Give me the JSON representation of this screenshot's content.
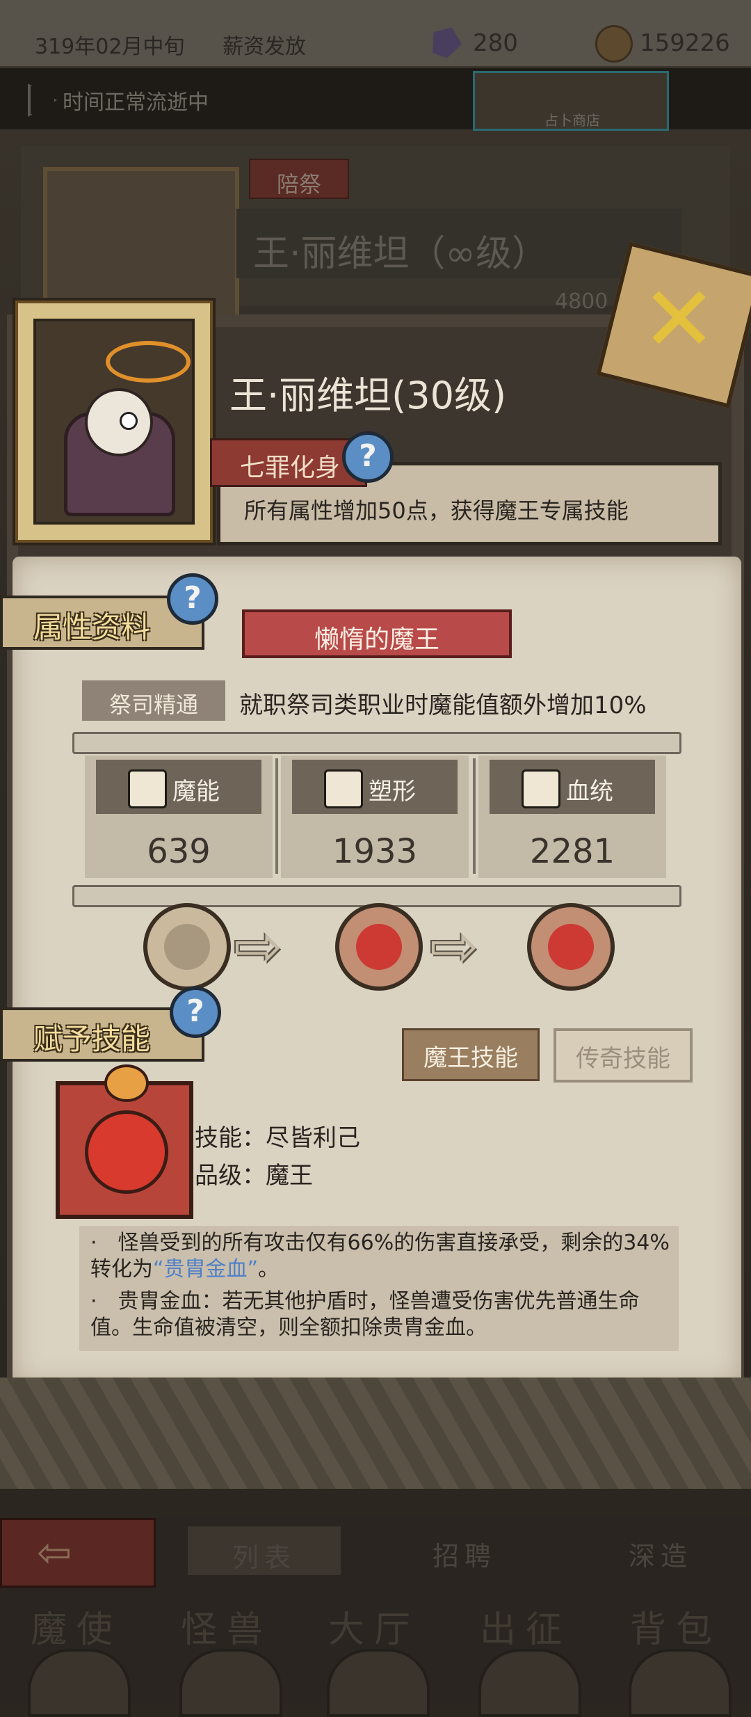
{
  "top_bar": {
    "date": "319年02月中旬",
    "event": "薪资发放",
    "gems": "280",
    "gold": "159226"
  },
  "time_bar": {
    "status": "时间正常流逝中",
    "shop_label": "占卜商店"
  },
  "background_panel": {
    "tag": "陪祭",
    "name": "王·丽维坦（∞级）",
    "number": "4800"
  },
  "hero": {
    "name": "王·丽维坦(30级)",
    "sin_title": "七罪化身",
    "sin_desc": "所有属性增加50点，获得魔王专属技能"
  },
  "attributes": {
    "section_label": "属性资料",
    "title": "懒惰的魔王",
    "mastery_label": "祭司精通",
    "mastery_desc": "就职祭司类职业时魔能值额外增加10%",
    "stats": [
      {
        "label": "魔能",
        "value": "639",
        "icon": "magic-fist-icon"
      },
      {
        "label": "塑形",
        "value": "1933",
        "icon": "armor-icon"
      },
      {
        "label": "血统",
        "value": "2281",
        "icon": "gear-sun-icon"
      }
    ]
  },
  "skill": {
    "section_label": "赋予技能",
    "tab_demon": "魔王技能",
    "tab_legend": "传奇技能",
    "name_line": "技能：尽皆利己",
    "grade_line": "品级：魔王",
    "desc_1a": "·　怪兽受到的所有攻击仅有66%的伤害直接承受，剩余的34%转化为",
    "desc_1_highlight": "“贵胄金血”",
    "desc_1b": "。",
    "desc_2": "·　贵胄金血：若无其他护盾时，怪兽遭受伤害优先普通生命值。生命值被清空，则全额扣除贵胄金血。"
  },
  "nav": {
    "tab_list": "列表",
    "tab_recruit": "招聘",
    "tab_forge": "深造",
    "menu": [
      "魔使",
      "怪兽",
      "大厅",
      "出征",
      "背包"
    ]
  },
  "colors": {
    "parchment": "#dbd3c2",
    "accent_red": "#b84a4a",
    "highlight_blue": "#4f7fc9",
    "title_gold": "#f3dd9d"
  }
}
